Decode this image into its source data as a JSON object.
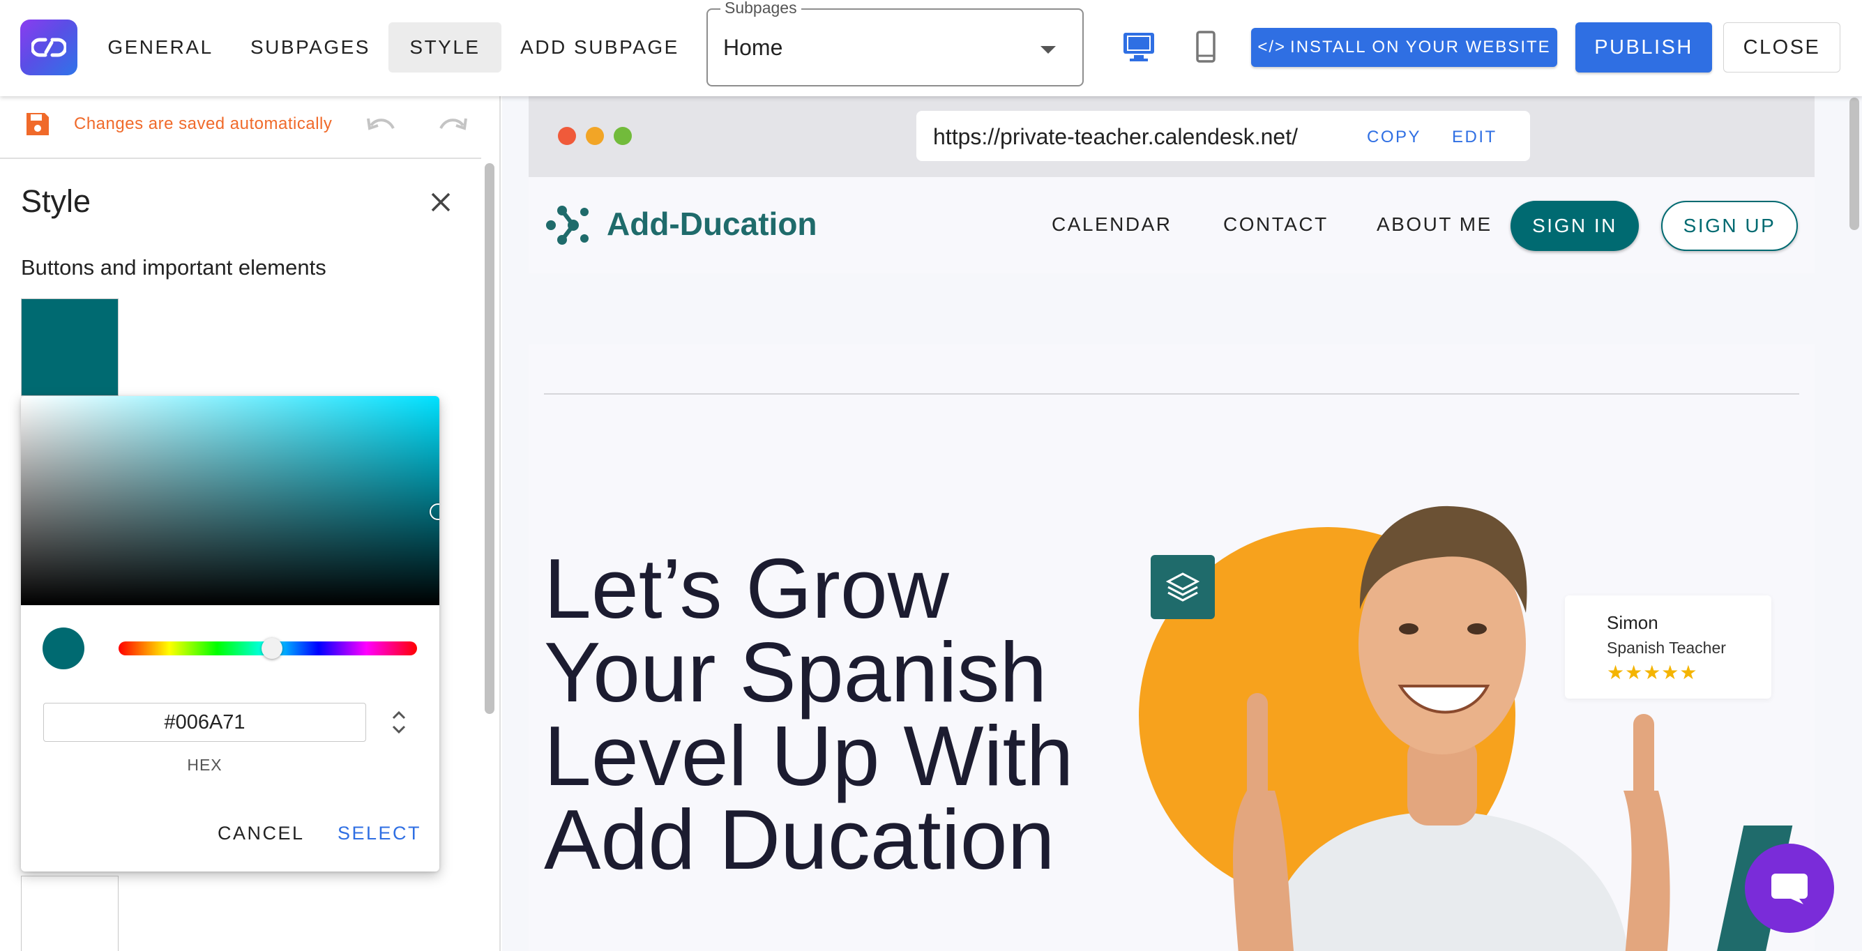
{
  "app": {
    "logo_icon": "link-icon",
    "tabs": [
      {
        "label": "GENERAL"
      },
      {
        "label": "SUBPAGES"
      },
      {
        "label": "STYLE",
        "active": true
      },
      {
        "label": "ADD SUBPAGE"
      }
    ],
    "subpages": {
      "legend": "Subpages",
      "value": "Home"
    },
    "devices": [
      {
        "icon": "desktop-icon",
        "active": true
      },
      {
        "icon": "mobile-icon",
        "active": false
      }
    ],
    "install_label": "INSTALL ON YOUR WEBSITE",
    "publish_label": "PUBLISH",
    "close_label": "CLOSE",
    "accent_color": "#2f6fe3"
  },
  "left_panel": {
    "autosave_text": "Changes are saved automatically",
    "autosave_color": "#f06a2a",
    "title": "Style",
    "subtitle": "Buttons and important elements",
    "swatch_color": "#006A71"
  },
  "color_picker": {
    "hex_value": "#006A71",
    "hex_label": "HEX",
    "cancel_label": "CANCEL",
    "select_label": "SELECT",
    "selected_color": "#006A71"
  },
  "preview": {
    "url": "https://private-teacher.calendesk.net/",
    "copy_label": "COPY",
    "edit_label": "EDIT",
    "site": {
      "brand": "Add-Ducation",
      "brand_color": "#1f6b6b",
      "nav": [
        "CALENDAR",
        "CONTACT",
        "ABOUT ME"
      ],
      "sign_in": "SIGN IN",
      "sign_up": "SIGN UP",
      "hero_title": "Let’s Grow Your Spanish Level Up With Add Ducation",
      "teacher_name": "Simon",
      "teacher_role": "Spanish Teacher",
      "teacher_stars": "★★★★★"
    }
  }
}
